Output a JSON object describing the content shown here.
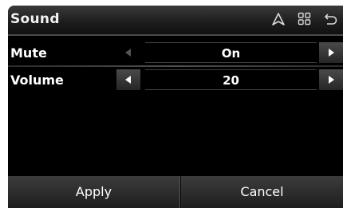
{
  "header": {
    "title": "Sound",
    "icons": [
      "navigation-arrow-icon",
      "grid-menu-icon",
      "back-icon"
    ]
  },
  "settings": [
    {
      "label": "Mute",
      "value": "On",
      "prev_enabled": false,
      "next_enabled": true
    },
    {
      "label": "Volume",
      "value": "20",
      "prev_enabled": true,
      "next_enabled": true
    }
  ],
  "footer": {
    "apply_label": "Apply",
    "cancel_label": "Cancel"
  },
  "colors": {
    "background": "#000000",
    "text": "#ffffff",
    "bar": "#2a2a2a"
  }
}
